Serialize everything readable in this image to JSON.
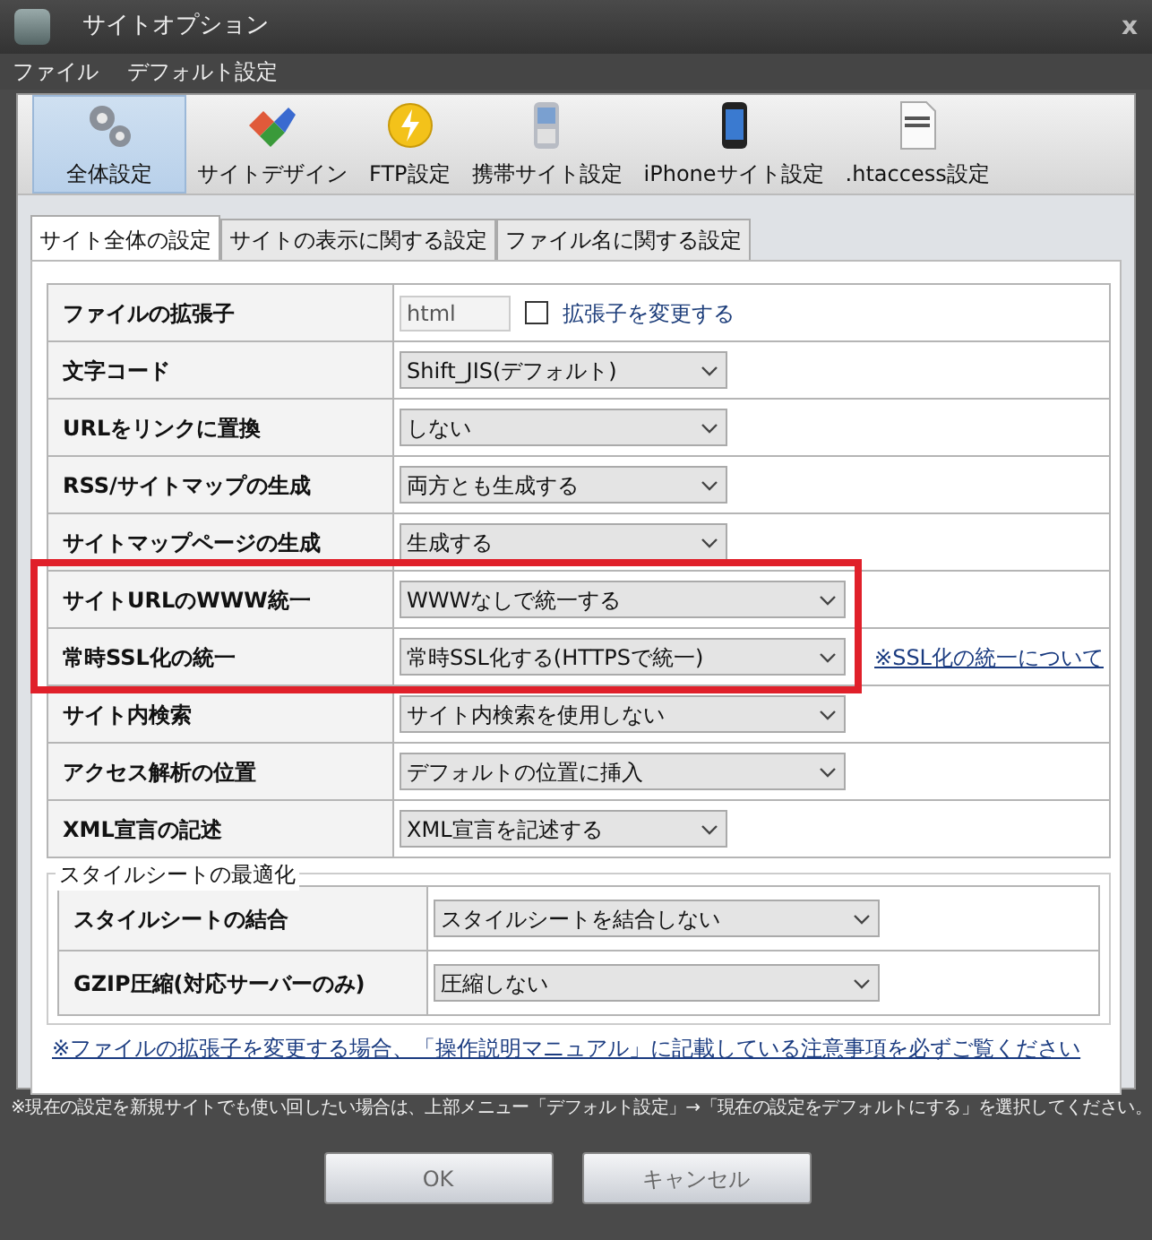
{
  "window": {
    "title": "サイトオプション",
    "close": "x"
  },
  "menu": [
    "ファイル",
    "デフォルト設定"
  ],
  "toolbar": [
    {
      "label": "全体設定",
      "selected": true
    },
    {
      "label": "サイトデザイン",
      "selected": false
    },
    {
      "label": "FTP設定",
      "selected": false
    },
    {
      "label": "携帯サイト設定",
      "selected": false
    },
    {
      "label": "iPhoneサイト設定",
      "selected": false
    },
    {
      "label": ".htaccess設定",
      "selected": false
    }
  ],
  "tabs": [
    {
      "label": "サイト全体の設定",
      "selected": true
    },
    {
      "label": "サイトの表示に関する設定",
      "selected": false
    },
    {
      "label": "ファイル名に関する設定",
      "selected": false
    }
  ],
  "settings": [
    {
      "label": "ファイルの拡張子",
      "kind": "text",
      "value": "html",
      "disabled": true,
      "checkbox": {
        "label": "拡張子を変更する",
        "checked": false
      }
    },
    {
      "label": "文字コード",
      "kind": "dropdown",
      "value": "Shift_JIS(デフォルト)"
    },
    {
      "label": "URLをリンクに置換",
      "kind": "dropdown",
      "value": "しない"
    },
    {
      "label": "RSS/サイトマップの生成",
      "kind": "dropdown",
      "value": "両方とも生成する"
    },
    {
      "label": "サイトマップページの生成",
      "kind": "dropdown",
      "value": "生成する"
    },
    {
      "label": "サイトURLのWWW統一",
      "kind": "wide-dropdown",
      "value": "WWWなしで統一する",
      "highlighted": true
    },
    {
      "label": "常時SSL化の統一",
      "kind": "wide-dropdown",
      "value": "常時SSL化する(HTTPSで統一)",
      "highlighted": true,
      "link": "※SSL化の統一について"
    },
    {
      "label": "サイト内検索",
      "kind": "wide-dropdown",
      "value": "サイト内検索を使用しない"
    },
    {
      "label": "アクセス解析の位置",
      "kind": "wide-dropdown",
      "value": "デフォルトの位置に挿入"
    },
    {
      "label": "XML宣言の記述",
      "kind": "dropdown",
      "value": "XML宣言を記述する"
    }
  ],
  "stylesheet_group": {
    "legend": "スタイルシートの最適化",
    "settings": [
      {
        "label": "スタイルシートの結合",
        "kind": "wide-dropdown",
        "value": "スタイルシートを結合しない"
      },
      {
        "label": "GZIP圧縮(対応サーバーのみ)",
        "kind": "wide-dropdown",
        "value": "圧縮しない"
      }
    ]
  },
  "manual_link": "※ファイルの拡張子を変更する場合、「操作説明マニュアル」に記載している注意事項を必ずご覧ください",
  "footer_note": "※現在の設定を新規サイトでも使い回したい場合は、上部メニュー「デフォルト設定」→「現在の設定をデフォルトにする」を選択してください。",
  "buttons": [
    "OK",
    "キャンセル"
  ]
}
